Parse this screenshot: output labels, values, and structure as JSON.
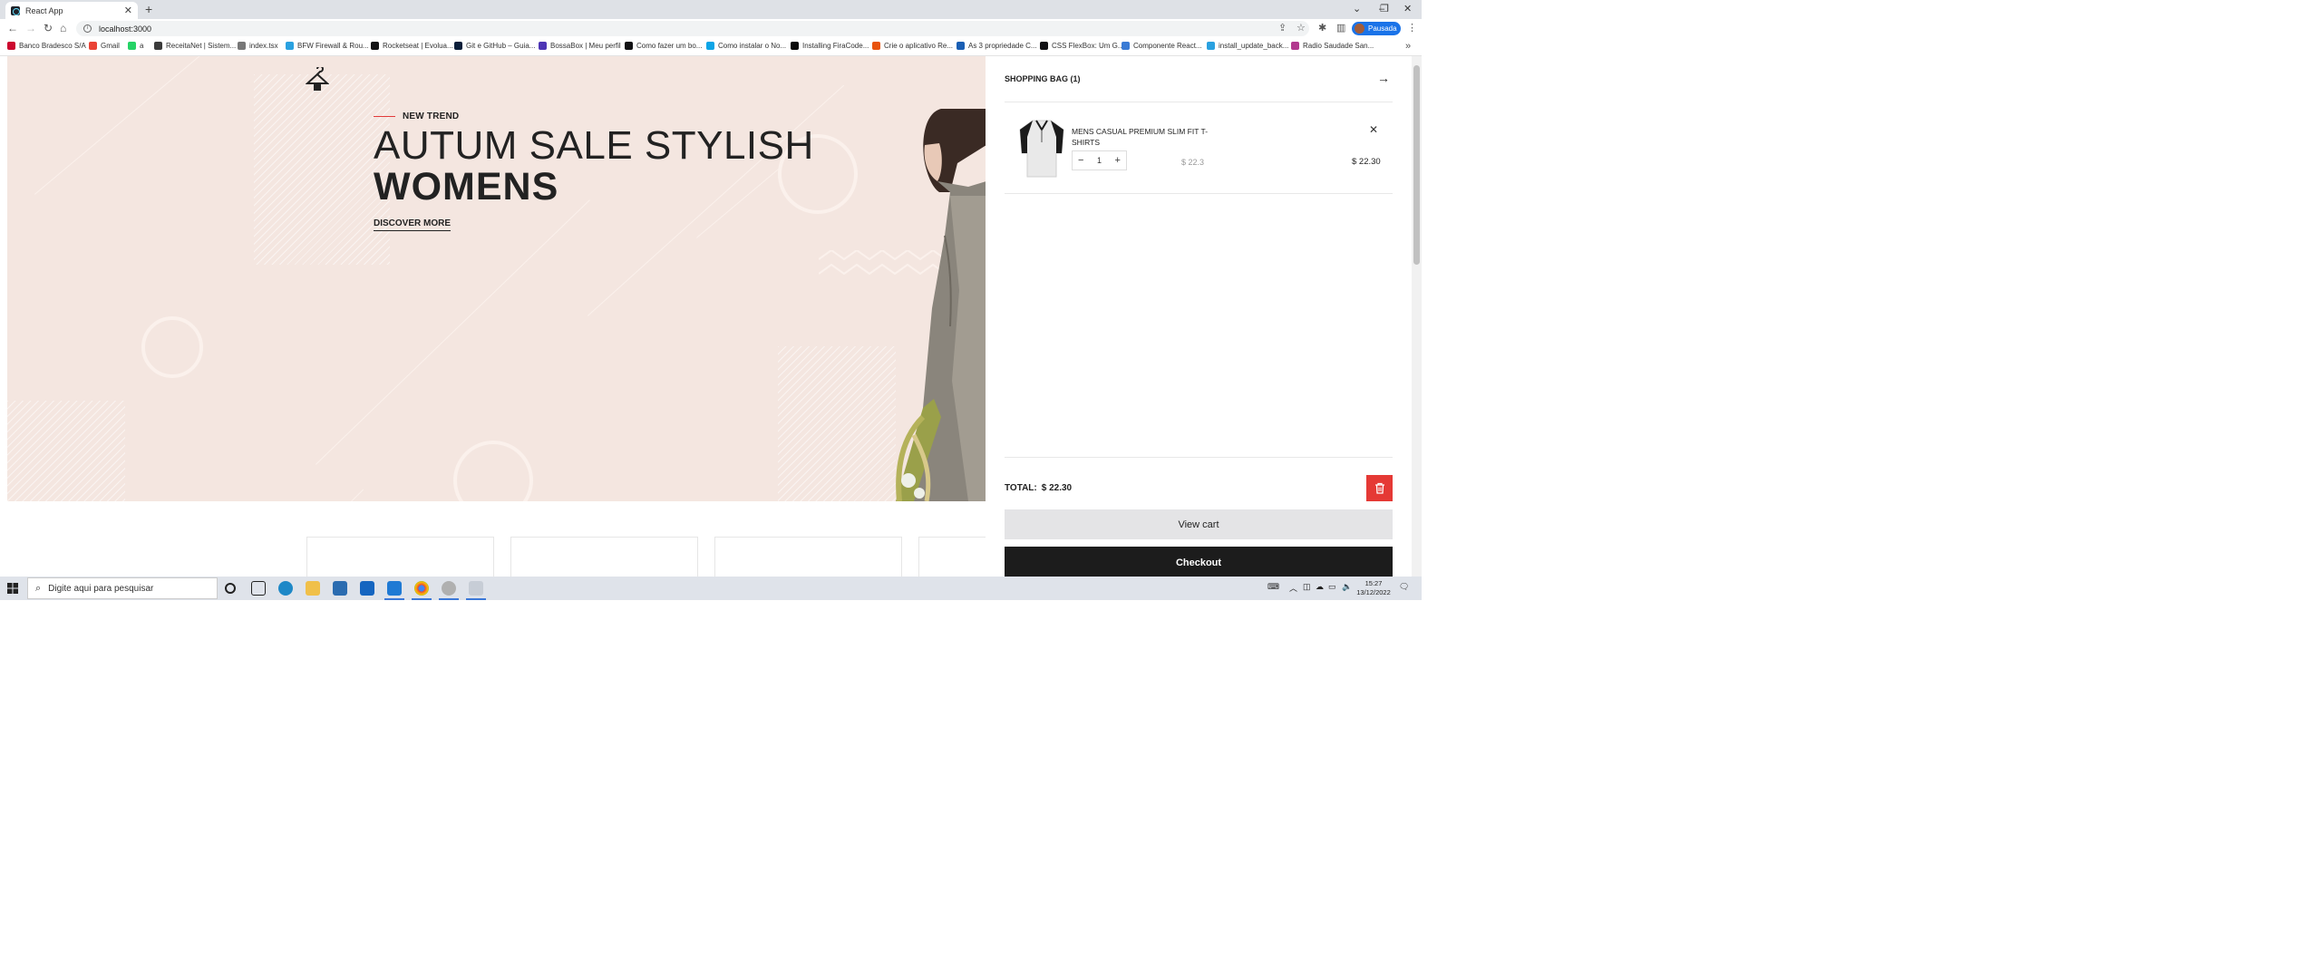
{
  "browser": {
    "tab_title": "React App",
    "url": "localhost:3000",
    "profile_label": "Pausada",
    "bookmarks": [
      "Banco Bradesco S/A",
      "Gmail",
      "a",
      "ReceitaNet | Sistem...",
      "index.tsx",
      "BFW Firewall & Rou...",
      "Rocketseat | Evolua...",
      "Git e GitHub – Guia...",
      "BossaBox | Meu perfil",
      "Como fazer um bo...",
      "Como instalar o No...",
      "Installing FiraCode...",
      "Crie o aplicativo Re...",
      "As 3 propriedade C...",
      "CSS FlexBox: Um G...",
      "Componente React...",
      "install_update_back...",
      "Radio Saudade San..."
    ],
    "bookmark_colors": [
      "#cc092f",
      "#ea4335",
      "#25d366",
      "#3b3b3b",
      "#777777",
      "#2aa1e0",
      "#121214",
      "#0b1f3a",
      "#4d35b5",
      "#121214",
      "#0da5e7",
      "#0a0a0a",
      "#e8530e",
      "#1a5fb4",
      "#121214",
      "#3a7bd5",
      "#2aa1e0",
      "#b23a8f"
    ]
  },
  "hero": {
    "tag": "NEW TREND",
    "headline_light": "AUTUM SALE STYLISH",
    "headline_bold": "WOMENS",
    "cta": "DISCOVER MORE"
  },
  "cart": {
    "title": "SHOPPING BAG (1)",
    "item": {
      "name": "MENS CASUAL PREMIUM SLIM FIT T-SHIRTS",
      "quantity": "1",
      "unit_price": "$ 22.3",
      "line_total": "$ 22.30"
    },
    "total_label": "TOTAL:",
    "total_value": "$ 22.30",
    "view_cart_label": "View cart",
    "checkout_label": "Checkout",
    "accent_color": "#e53935"
  },
  "taskbar": {
    "search_placeholder": "Digite aqui para pesquisar",
    "time": "15:27",
    "date": "13/12/2022"
  }
}
